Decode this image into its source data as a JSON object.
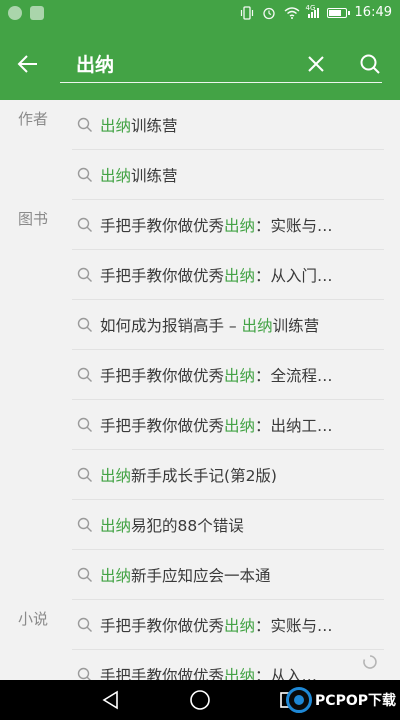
{
  "status_bar": {
    "time": "16:49",
    "network_label": "4G",
    "battery_level": 0.7
  },
  "search": {
    "query": "出纳"
  },
  "sections": [
    {
      "label": "作者",
      "items": [
        {
          "segments": [
            {
              "t": "出纳",
              "hl": true
            },
            {
              "t": "训练营",
              "hl": false
            }
          ]
        },
        {
          "segments": [
            {
              "t": "出纳",
              "hl": true
            },
            {
              "t": "训练营",
              "hl": false
            }
          ]
        }
      ]
    },
    {
      "label": "图书",
      "items": [
        {
          "segments": [
            {
              "t": "手把手教你做优秀",
              "hl": false
            },
            {
              "t": "出纳",
              "hl": true
            },
            {
              "t": "：实账与…",
              "hl": false
            }
          ]
        },
        {
          "segments": [
            {
              "t": "手把手教你做优秀",
              "hl": false
            },
            {
              "t": "出纳",
              "hl": true
            },
            {
              "t": "：从入门…",
              "hl": false
            }
          ]
        },
        {
          "segments": [
            {
              "t": "如何成为报销高手 – ",
              "hl": false
            },
            {
              "t": "出纳",
              "hl": true
            },
            {
              "t": "训练营",
              "hl": false
            }
          ]
        },
        {
          "segments": [
            {
              "t": "手把手教你做优秀",
              "hl": false
            },
            {
              "t": "出纳",
              "hl": true
            },
            {
              "t": "：全流程…",
              "hl": false
            }
          ]
        },
        {
          "segments": [
            {
              "t": "手把手教你做优秀",
              "hl": false
            },
            {
              "t": "出纳",
              "hl": true
            },
            {
              "t": "：出纳工…",
              "hl": false
            }
          ]
        },
        {
          "segments": [
            {
              "t": "出纳",
              "hl": true
            },
            {
              "t": "新手成长手记(第2版)",
              "hl": false
            }
          ]
        },
        {
          "segments": [
            {
              "t": "出纳",
              "hl": true
            },
            {
              "t": "易犯的88个错误",
              "hl": false
            }
          ]
        },
        {
          "segments": [
            {
              "t": "出纳",
              "hl": true
            },
            {
              "t": "新手应知应会一本通",
              "hl": false
            }
          ]
        }
      ]
    },
    {
      "label": "小说",
      "items": [
        {
          "segments": [
            {
              "t": "手把手教你做优秀",
              "hl": false
            },
            {
              "t": "出纳",
              "hl": true
            },
            {
              "t": "：实账与…",
              "hl": false
            }
          ]
        },
        {
          "segments": [
            {
              "t": "手把手教你做优秀",
              "hl": false
            },
            {
              "t": "出纳",
              "hl": true
            },
            {
              "t": "：从入…",
              "hl": false
            }
          ]
        }
      ]
    }
  ],
  "icons": {
    "back": "arrow-left-icon",
    "clear": "close-icon",
    "search": "search-icon",
    "result": "search-icon"
  },
  "colors": {
    "brand_green": "#43a345",
    "highlight_green": "#43a345",
    "text_primary": "#3a3a3a",
    "text_secondary": "#8a8a8a",
    "background": "#f2f2f2"
  },
  "watermark": {
    "text": "PCPOP下载"
  }
}
